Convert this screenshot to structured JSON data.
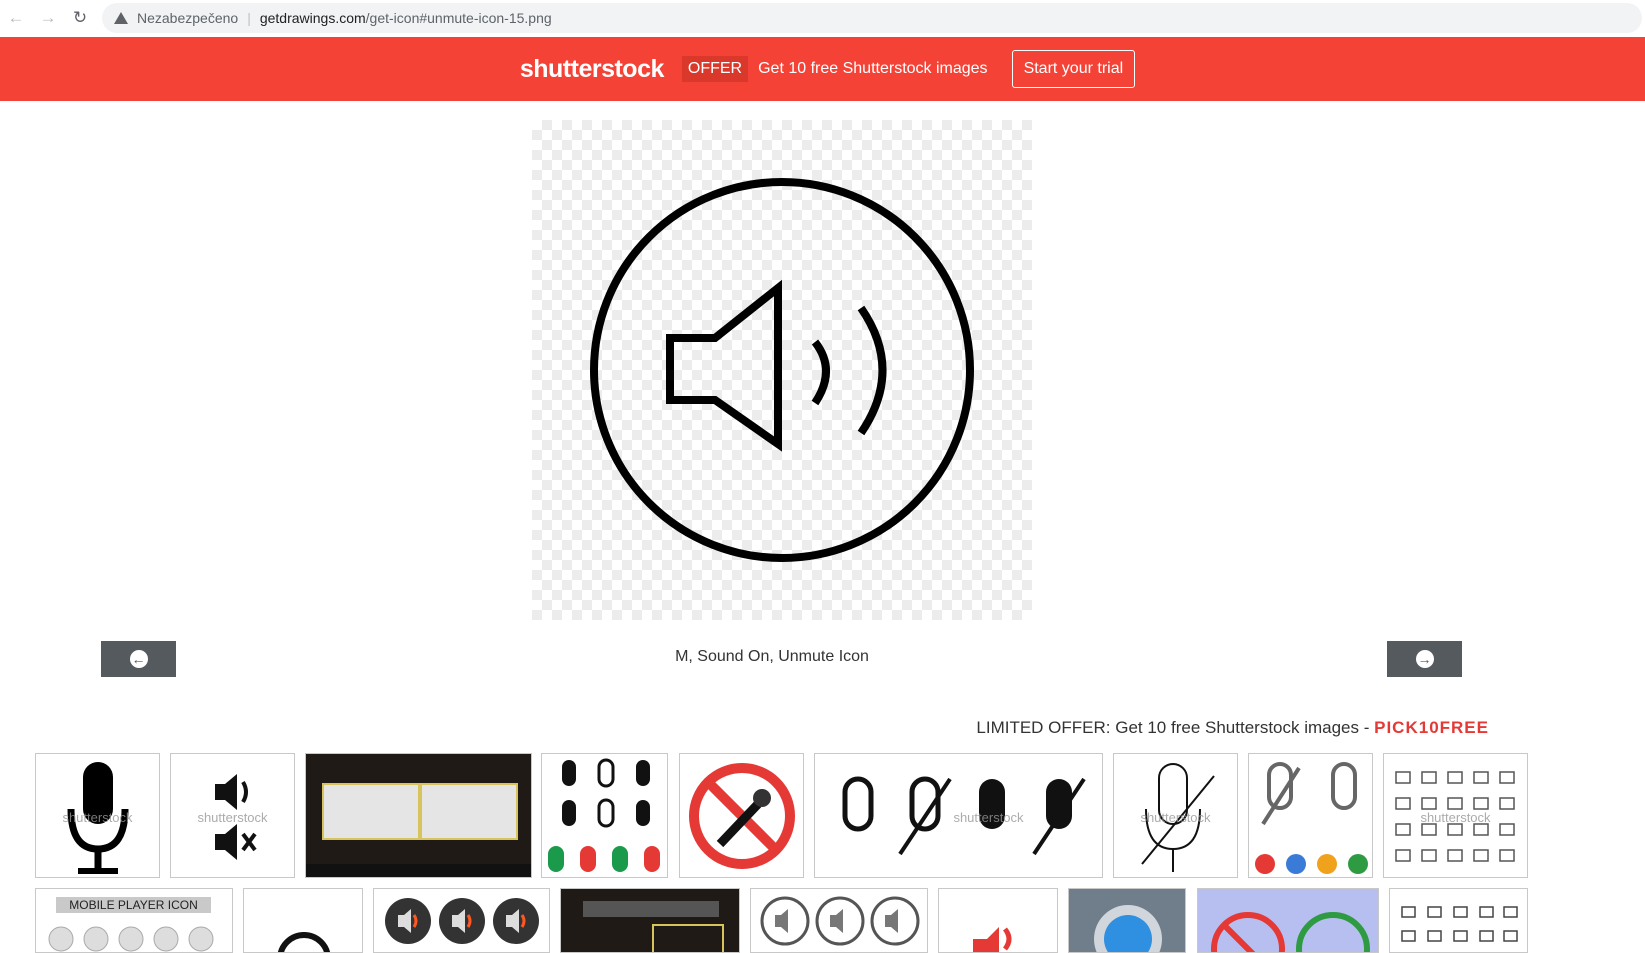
{
  "browser": {
    "security_label": "Nezabezpečeno",
    "url_host": "getdrawings.com",
    "url_path": "/get-icon#unmute-icon-15.png",
    "icons": [
      "back-arrow-icon",
      "forward-arrow-icon",
      "reload-icon",
      "warning-icon"
    ]
  },
  "banner": {
    "logo": "shutterstock",
    "offer_badge": "OFFER",
    "offer_text": "Get 10 free Shutterstock images",
    "cta": "Start your trial",
    "color": "#f44336"
  },
  "preview": {
    "caption": "M, Sound On, Unmute Icon",
    "icon": "speaker-sound-on-circle-icon"
  },
  "pagination": {
    "prev_icon": "arrow-left-circle-icon",
    "next_icon": "arrow-right-circle-icon"
  },
  "promo": {
    "text": "LIMITED OFFER: Get 10 free Shutterstock images - ",
    "code": "PICK10FREE"
  },
  "thumbnails": {
    "watermark": "shutterstock",
    "row2_label": "MOBILE PLAYER ICON"
  }
}
